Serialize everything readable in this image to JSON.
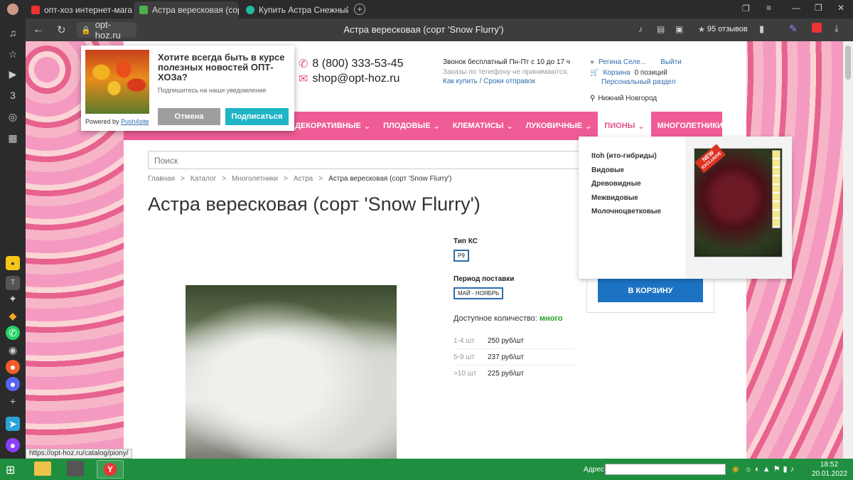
{
  "tabs": [
    {
      "label": "опт-хоз интернет-магазин",
      "icon": "yandex-icon"
    },
    {
      "label": "Астра вересковая (сорт",
      "icon": "page-icon"
    },
    {
      "label": "Купить Астра Снежный го",
      "icon": "flower-icon"
    }
  ],
  "address": {
    "domain": "opt-hoz.ru",
    "title": "Астра вересковая (сорт 'Snow Flurry')",
    "reviews": "95 отзывов"
  },
  "push": {
    "title": "Хотите всегда быть в курсе полезных новостей ОПТ-ХОЗа?",
    "subtitle": "Подпишитесь на наши уведомления",
    "powered": "Powered by",
    "powered_link": "Push4site",
    "cancel": "Отмена",
    "subscribe": "Подписаться"
  },
  "header": {
    "phone": "8 (800) 333-53-45",
    "email": "shop@opt-hoz.ru",
    "call_info": "Звонок бесплатный Пн-Пт с 10 до 17 ч",
    "no_orders": "Заказы по телефону не принимаются.",
    "how_to_buy": "Как купить",
    "separator": "/",
    "delivery": "Сроки отправок",
    "user": "Регина Селе...",
    "logout": "Выйти",
    "cart": "Корзина",
    "cart_count": "0 позиций",
    "personal": "Персональный раздел",
    "city": "Нижний Новгород"
  },
  "nav": [
    {
      "label": "ДЕКОРАТИВНЫЕ"
    },
    {
      "label": "ПЛОДОВЫЕ"
    },
    {
      "label": "КЛЕМАТИСЫ"
    },
    {
      "label": "ЛУКОВИЧНЫЕ"
    },
    {
      "label": "ПИОНЫ"
    },
    {
      "label": "МНОГОЛЕТНИКИ"
    }
  ],
  "dropdown": [
    "Itoh (ито-гибриды)",
    "Видовые",
    "Древовидные",
    "Межвидовые",
    "Молочноцветковые"
  ],
  "dropdown_badge": {
    "line1": "NEW",
    "line2": "EXCLUSIVE"
  },
  "search": {
    "placeholder": "Поиск"
  },
  "breadcrumbs": [
    "Главная",
    "Каталог",
    "Многолетники",
    "Астра",
    "Астра вересковая (сорт 'Snow Flurry')"
  ],
  "breadcrumb_sep": ">",
  "product": {
    "title": "Астра вересковая (сорт 'Snow Flurry')",
    "type_label": "Тип КС",
    "type_value": "P9",
    "period_label": "Период поставки",
    "period_value": "МАЙ - НОЯБРЬ",
    "qty_label": "Доступное количество:",
    "qty_value": "много",
    "prices": [
      {
        "range": "1-4 шт",
        "price": "250 руб/шт"
      },
      {
        "range": "5-9 шт",
        "price": "237 руб/шт"
      },
      {
        "range": ">10 шт",
        "price": "225 руб/шт"
      }
    ],
    "cart_button": "В КОРЗИНУ"
  },
  "status_url": "https://opt-hoz.ru/catalog/piony/",
  "taskbar": {
    "address_label": "Адрес",
    "time": "18:52",
    "date": "20.01.2022"
  }
}
